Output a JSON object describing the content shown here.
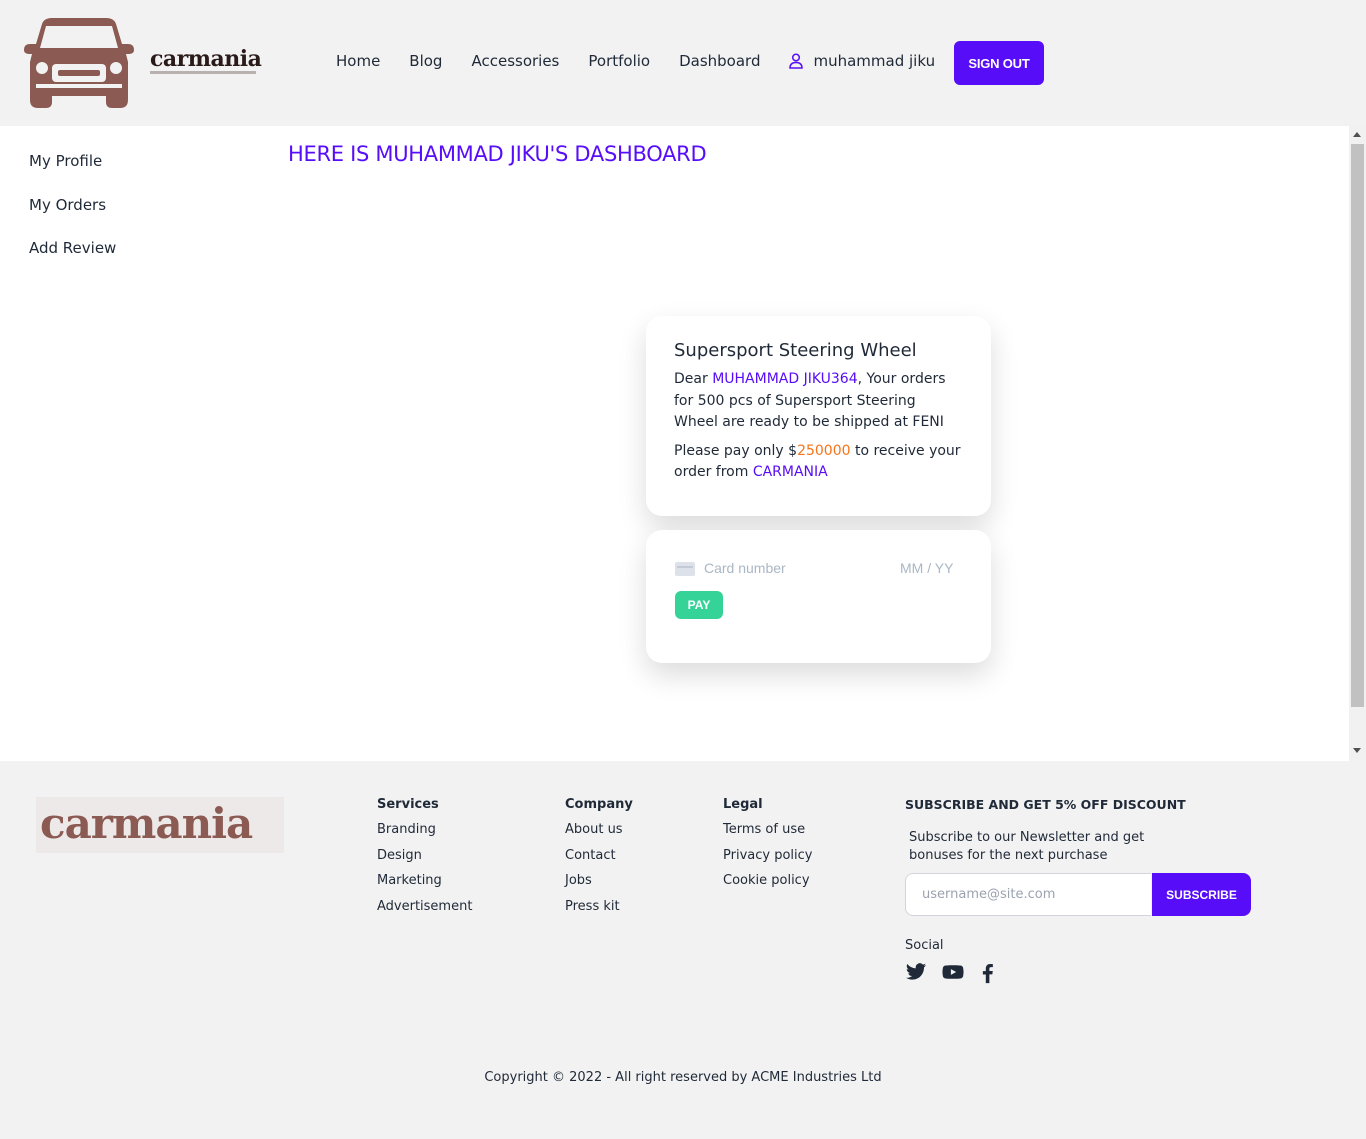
{
  "brand": {
    "name": "carmania"
  },
  "nav": {
    "items": [
      "Home",
      "Blog",
      "Accessories",
      "Portfolio",
      "Dashboard"
    ],
    "user_name": "muhammad jiku",
    "signout_label": "SIGN OUT"
  },
  "sidebar": {
    "items": [
      "My Profile",
      "My Orders",
      "Add Review"
    ]
  },
  "dashboard": {
    "title": "HERE IS MUHAMMAD JIKU'S DASHBOARD"
  },
  "order": {
    "product": "Supersport Steering Wheel",
    "dear": "Dear",
    "username": "MUHAMMAD JIKU364",
    "message": ", Your orders for 500 pcs of Supersport Steering Wheel are ready to be shipped at FENI",
    "pay_prefix": "Please pay only $",
    "amount": "250000",
    "pay_suffix": " to receive your order from ",
    "store": "CARMANIA"
  },
  "payment": {
    "card_placeholder": "Card number",
    "expiry_placeholder": "MM / YY",
    "pay_label": "PAY"
  },
  "footer": {
    "logo_text": "carmania",
    "services": {
      "title": "Services",
      "links": [
        "Branding",
        "Design",
        "Marketing",
        "Advertisement"
      ]
    },
    "company": {
      "title": "Company",
      "links": [
        "About us",
        "Contact",
        "Jobs",
        "Press kit"
      ]
    },
    "legal": {
      "title": "Legal",
      "links": [
        "Terms of use",
        "Privacy policy",
        "Cookie policy"
      ]
    },
    "subscribe": {
      "title": "SUBSCRIBE AND GET 5% OFF DISCOUNT",
      "text": "Subscribe to our Newsletter and get bonuses for the next purchase",
      "placeholder": "username@site.com",
      "button": "SUBSCRIBE"
    },
    "social": {
      "title": "Social",
      "icons": [
        "twitter-icon",
        "youtube-icon",
        "facebook-icon"
      ]
    },
    "copyright": "Copyright © 2022 - All right reserved by ACME Industries Ltd"
  },
  "colors": {
    "primary": "#570df8",
    "success": "#36d399",
    "accent": "#f97316",
    "brand": "#8b5a52"
  }
}
